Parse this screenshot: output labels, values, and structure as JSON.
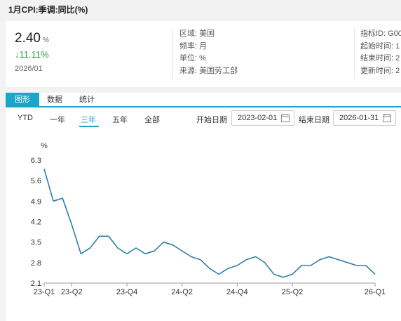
{
  "header": {
    "title": "1月CPI:季调:同比(%)"
  },
  "summary": {
    "value": "2.40",
    "unit": "%",
    "change": "↓11.11%",
    "period": "2026/01"
  },
  "meta_left": [
    {
      "label": "区域:",
      "value": "美国"
    },
    {
      "label": "频率:",
      "value": "月"
    },
    {
      "label": "单位:",
      "value": "%"
    },
    {
      "label": "来源:",
      "value": "美国劳工部"
    }
  ],
  "meta_right": [
    {
      "label": "指标ID:",
      "value": "G00"
    },
    {
      "label": "起始时间:",
      "value": "1"
    },
    {
      "label": "结束时间:",
      "value": "2"
    },
    {
      "label": "更新时间:",
      "value": "2"
    }
  ],
  "tabs": [
    "图形",
    "数据",
    "统计"
  ],
  "ranges": [
    "YTD",
    "一年",
    "三年",
    "五年",
    "全部"
  ],
  "date_range": {
    "start_label": "开始日期",
    "start_value": "2023-02-01",
    "end_label": "结束日期",
    "end_value": "2026-01-31"
  },
  "colors": {
    "accent": "#1aa6c6",
    "line": "#2f7fa8",
    "down": "#2a9d3a"
  },
  "chart_data": {
    "type": "line",
    "ylabel": "%",
    "ylim": [
      2.1,
      6.3
    ],
    "y_ticks": [
      6.3,
      5.6,
      4.9,
      4.2,
      3.5,
      2.8,
      2.1
    ],
    "y_tick_labels": [
      "6.3",
      "5.6",
      "4.9",
      "4.2",
      "3.5",
      "2.8",
      "2.1"
    ],
    "x_tick_labels": [
      "23-Q1",
      "23-Q2",
      "23-Q4",
      "24-Q2",
      "24-Q4",
      "25-Q2",
      "26-Q1"
    ],
    "x": [
      "2023-01",
      "2023-02",
      "2023-03",
      "2023-04",
      "2023-05",
      "2023-06",
      "2023-07",
      "2023-08",
      "2023-09",
      "2023-10",
      "2023-11",
      "2023-12",
      "2024-01",
      "2024-02",
      "2024-03",
      "2024-04",
      "2024-05",
      "2024-06",
      "2024-07",
      "2024-08",
      "2024-09",
      "2024-10",
      "2024-11",
      "2024-12",
      "2025-01",
      "2025-02",
      "2025-03",
      "2025-04",
      "2025-05",
      "2025-06",
      "2025-07",
      "2025-08",
      "2025-09",
      "2025-10",
      "2025-11",
      "2025-12",
      "2026-01"
    ],
    "series": [
      {
        "values": [
          6.0,
          4.9,
          5.0,
          4.1,
          3.1,
          3.3,
          3.7,
          3.7,
          3.3,
          3.1,
          3.3,
          3.1,
          3.2,
          3.5,
          3.4,
          3.2,
          3.0,
          2.9,
          2.6,
          2.4,
          2.6,
          2.7,
          2.9,
          3.0,
          2.8,
          2.4,
          2.3,
          2.4,
          2.7,
          2.7,
          2.9,
          3.0,
          2.9,
          2.8,
          2.7,
          2.7,
          2.4
        ]
      }
    ],
    "grid": false,
    "legend": "none"
  }
}
